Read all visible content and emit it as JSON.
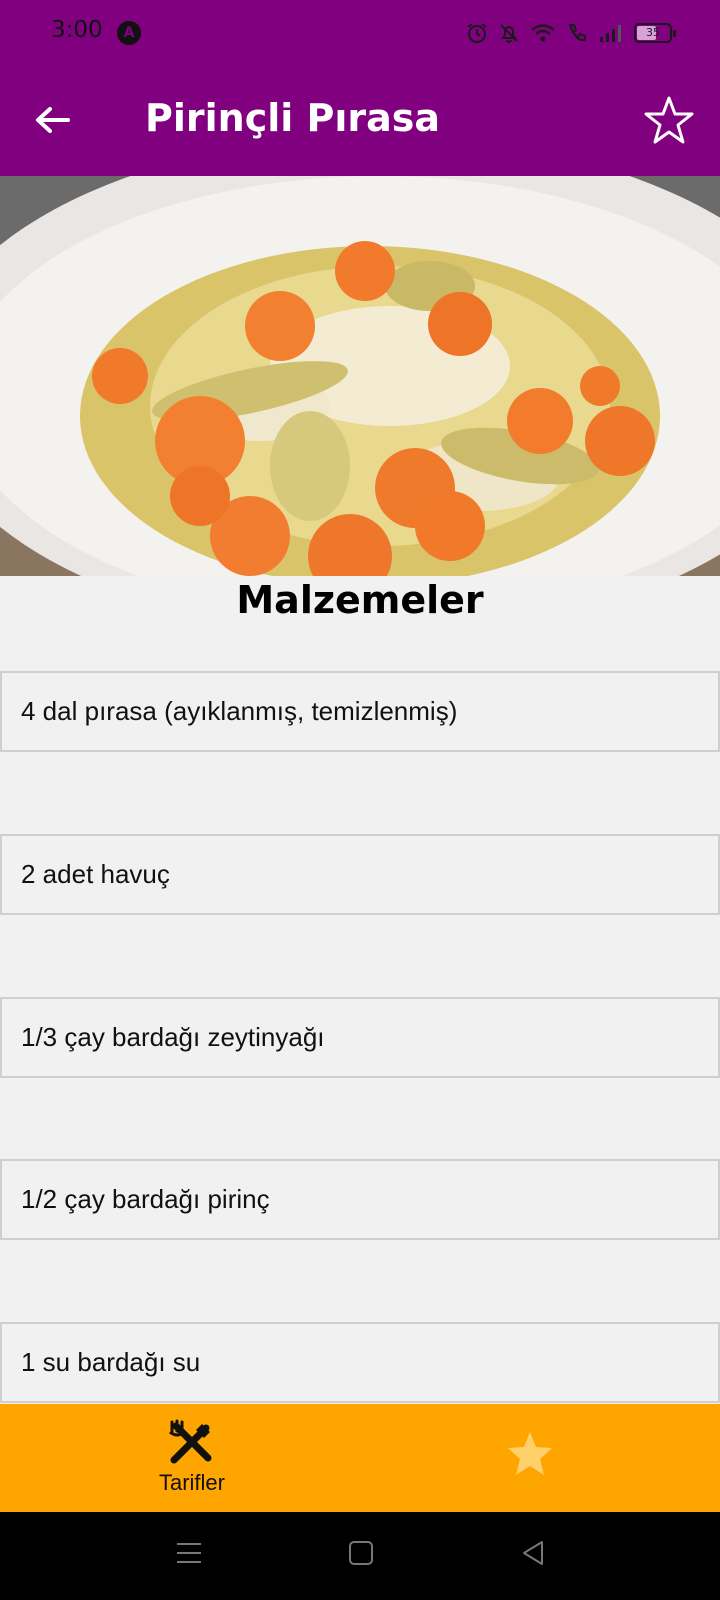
{
  "status_bar": {
    "time": "3:00",
    "app_badge": "A",
    "battery_level": "35",
    "icons": [
      "alarm-icon",
      "bell-off-icon",
      "wifi-icon",
      "call-icon",
      "signal-icon",
      "battery-icon"
    ]
  },
  "app_bar": {
    "title": "Pirinçli Pırasa",
    "back_icon": "arrow-left-icon",
    "favorite_icon": "star-outline-icon",
    "background_color": "#800080"
  },
  "hero_image": {
    "subject": "dish-photo"
  },
  "ingredients_section": {
    "title": "Malzemeler",
    "items": [
      "4 dal pırasa (ayıklanmış, temizlenmiş)",
      "2 adet havuç",
      "1/3 çay bardağı zeytinyağı",
      "1/2 çay bardağı pirinç",
      "1 su bardağı su"
    ]
  },
  "bottom_nav": {
    "background_color": "#ffa500",
    "items": [
      {
        "label": "Tarifler",
        "icon": "fork-knife-icon",
        "active": true
      },
      {
        "label": "",
        "icon": "star-icon",
        "active": false
      }
    ]
  },
  "system_nav": {
    "buttons": [
      "menu-icon",
      "home-icon",
      "back-triangle-icon"
    ]
  }
}
